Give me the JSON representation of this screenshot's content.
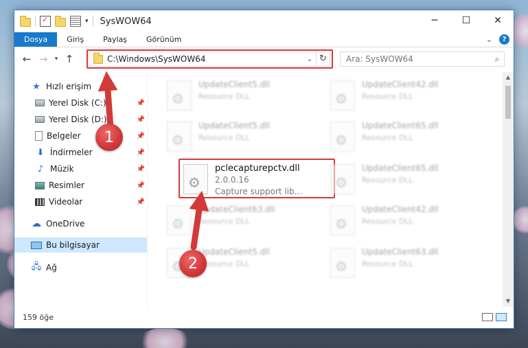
{
  "window": {
    "title": "SysWOW64",
    "controls": {
      "minimize": "─",
      "maximize": "☐",
      "close": "✕"
    }
  },
  "ribbon": {
    "tabs": [
      "Dosya",
      "Giriş",
      "Paylaş",
      "Görünüm"
    ],
    "help": "?"
  },
  "navigation": {
    "address_path": "C:\\Windows\\SysWOW64",
    "search_placeholder": "Ara: SysWOW64"
  },
  "sidebar": {
    "items": [
      {
        "label": "Hızlı erişim",
        "icon": "star-icon"
      },
      {
        "label": "Yerel Disk (C:)",
        "icon": "drive-icon",
        "pinned": true
      },
      {
        "label": "Yerel Disk (D:)",
        "icon": "drive-icon",
        "pinned": true
      },
      {
        "label": "Belgeler",
        "icon": "documents-icon",
        "pinned": true
      },
      {
        "label": "İndirmeler",
        "icon": "downloads-icon",
        "pinned": true
      },
      {
        "label": "Müzik",
        "icon": "music-icon",
        "pinned": true
      },
      {
        "label": "Resimler",
        "icon": "pictures-icon",
        "pinned": true
      },
      {
        "label": "Videolar",
        "icon": "videos-icon",
        "pinned": true
      },
      {
        "label": "OneDrive",
        "icon": "cloud-icon"
      },
      {
        "label": "Bu bilgisayar",
        "icon": "computer-icon",
        "selected": true
      },
      {
        "label": "Ağ",
        "icon": "network-icon"
      }
    ]
  },
  "files": {
    "left_column": [
      {
        "name": "UpdateClient5.dll",
        "type": "Resource DLL"
      },
      {
        "name": "UpdateClient5.dll",
        "type": "Resource DLL"
      },
      {
        "name": "pclecapturepctv.dll",
        "version": "2.0.0.16",
        "description": "Capture support lib..."
      },
      {
        "name": "UpdateClient63.dll",
        "type": "Resource DLL"
      },
      {
        "name": "UpdateClient5.dll",
        "type": "Resource DLL"
      }
    ],
    "right_column": [
      {
        "name": "UpdateClient42.dll",
        "type": "Resource DLL"
      },
      {
        "name": "UpdateClient65.dll",
        "type": "Resource DLL"
      },
      {
        "name": "UpdateClient65.dll",
        "type": "Resource DLL"
      },
      {
        "name": "UpdateClient42.dll",
        "type": "Resource DLL"
      },
      {
        "name": "UpdateClient63.dll",
        "type": "Resource DLL"
      }
    ]
  },
  "status": {
    "item_count": "159 öğe"
  },
  "callouts": {
    "step1": "1",
    "step2": "2"
  },
  "colors": {
    "accent": "#1979ca",
    "highlight": "#d23a3a",
    "selection": "#cde8ff"
  }
}
